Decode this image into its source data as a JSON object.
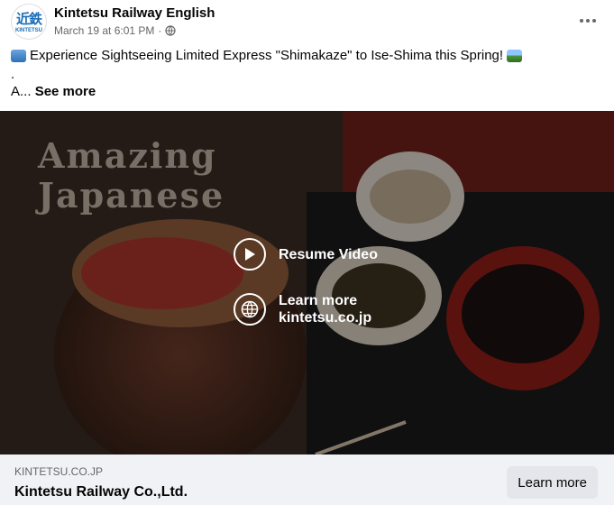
{
  "post": {
    "page_name": "Kintetsu Railway English",
    "timestamp": "March 19 at 6:01 PM",
    "separator": "·",
    "avatar": {
      "kanji": "近鉄",
      "text": "KINTETSU"
    },
    "audience_icon": "globe-icon",
    "more_icon": "more-horizontal-icon",
    "text": {
      "line1": "Experience Sightseeing Limited Express \"Shimakaze\" to Ise-Shima this Spring!",
      "line2": ".",
      "line3_prefix": "A...",
      "see_more": "See more"
    }
  },
  "video": {
    "title_line1": "Amazing",
    "title_line2": "Japanese",
    "resume_label": "Resume Video",
    "learn_more_label": "Learn more",
    "learn_more_domain": "kintetsu.co.jp",
    "play_icon": "play-icon",
    "globe_icon": "globe-icon"
  },
  "link": {
    "domain": "KINTETSU.CO.JP",
    "title": "Kintetsu Railway Co.,Ltd.",
    "button": "Learn more"
  },
  "colors": {
    "brand": "#1b6fb8",
    "footer_bg": "#f0f2f5",
    "button_bg": "#e4e6eb",
    "secondary_text": "#65676b"
  }
}
